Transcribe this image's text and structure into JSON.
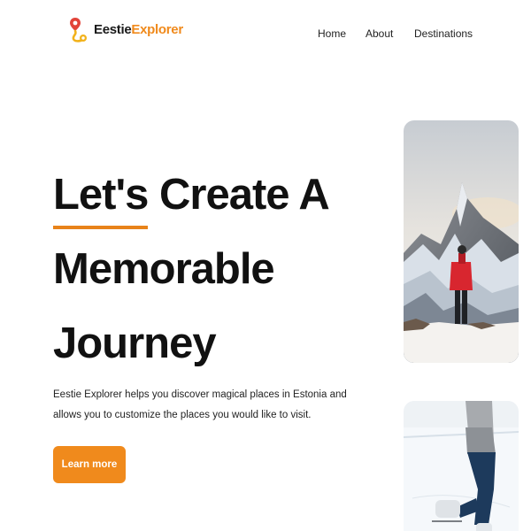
{
  "brand": {
    "name_part1": "Eestie",
    "name_part2": "Explorer",
    "accent_color": "#f08a1c"
  },
  "nav": {
    "items": [
      {
        "label": "Home"
      },
      {
        "label": "About"
      },
      {
        "label": "Destinations"
      }
    ]
  },
  "hero": {
    "line1_underlined": "Let's",
    "line1_rest": " Create A",
    "line2": "Memorable",
    "line3": "Journey",
    "description": "Eestie Explorer helps you discover magical places in Estonia and allows you to customize the places you would like to visit.",
    "cta_label": "Learn more"
  },
  "gallery": {
    "images": [
      {
        "subject": "hiker-on-snowy-mountain"
      },
      {
        "subject": "ice-skater-on-rink"
      }
    ]
  }
}
